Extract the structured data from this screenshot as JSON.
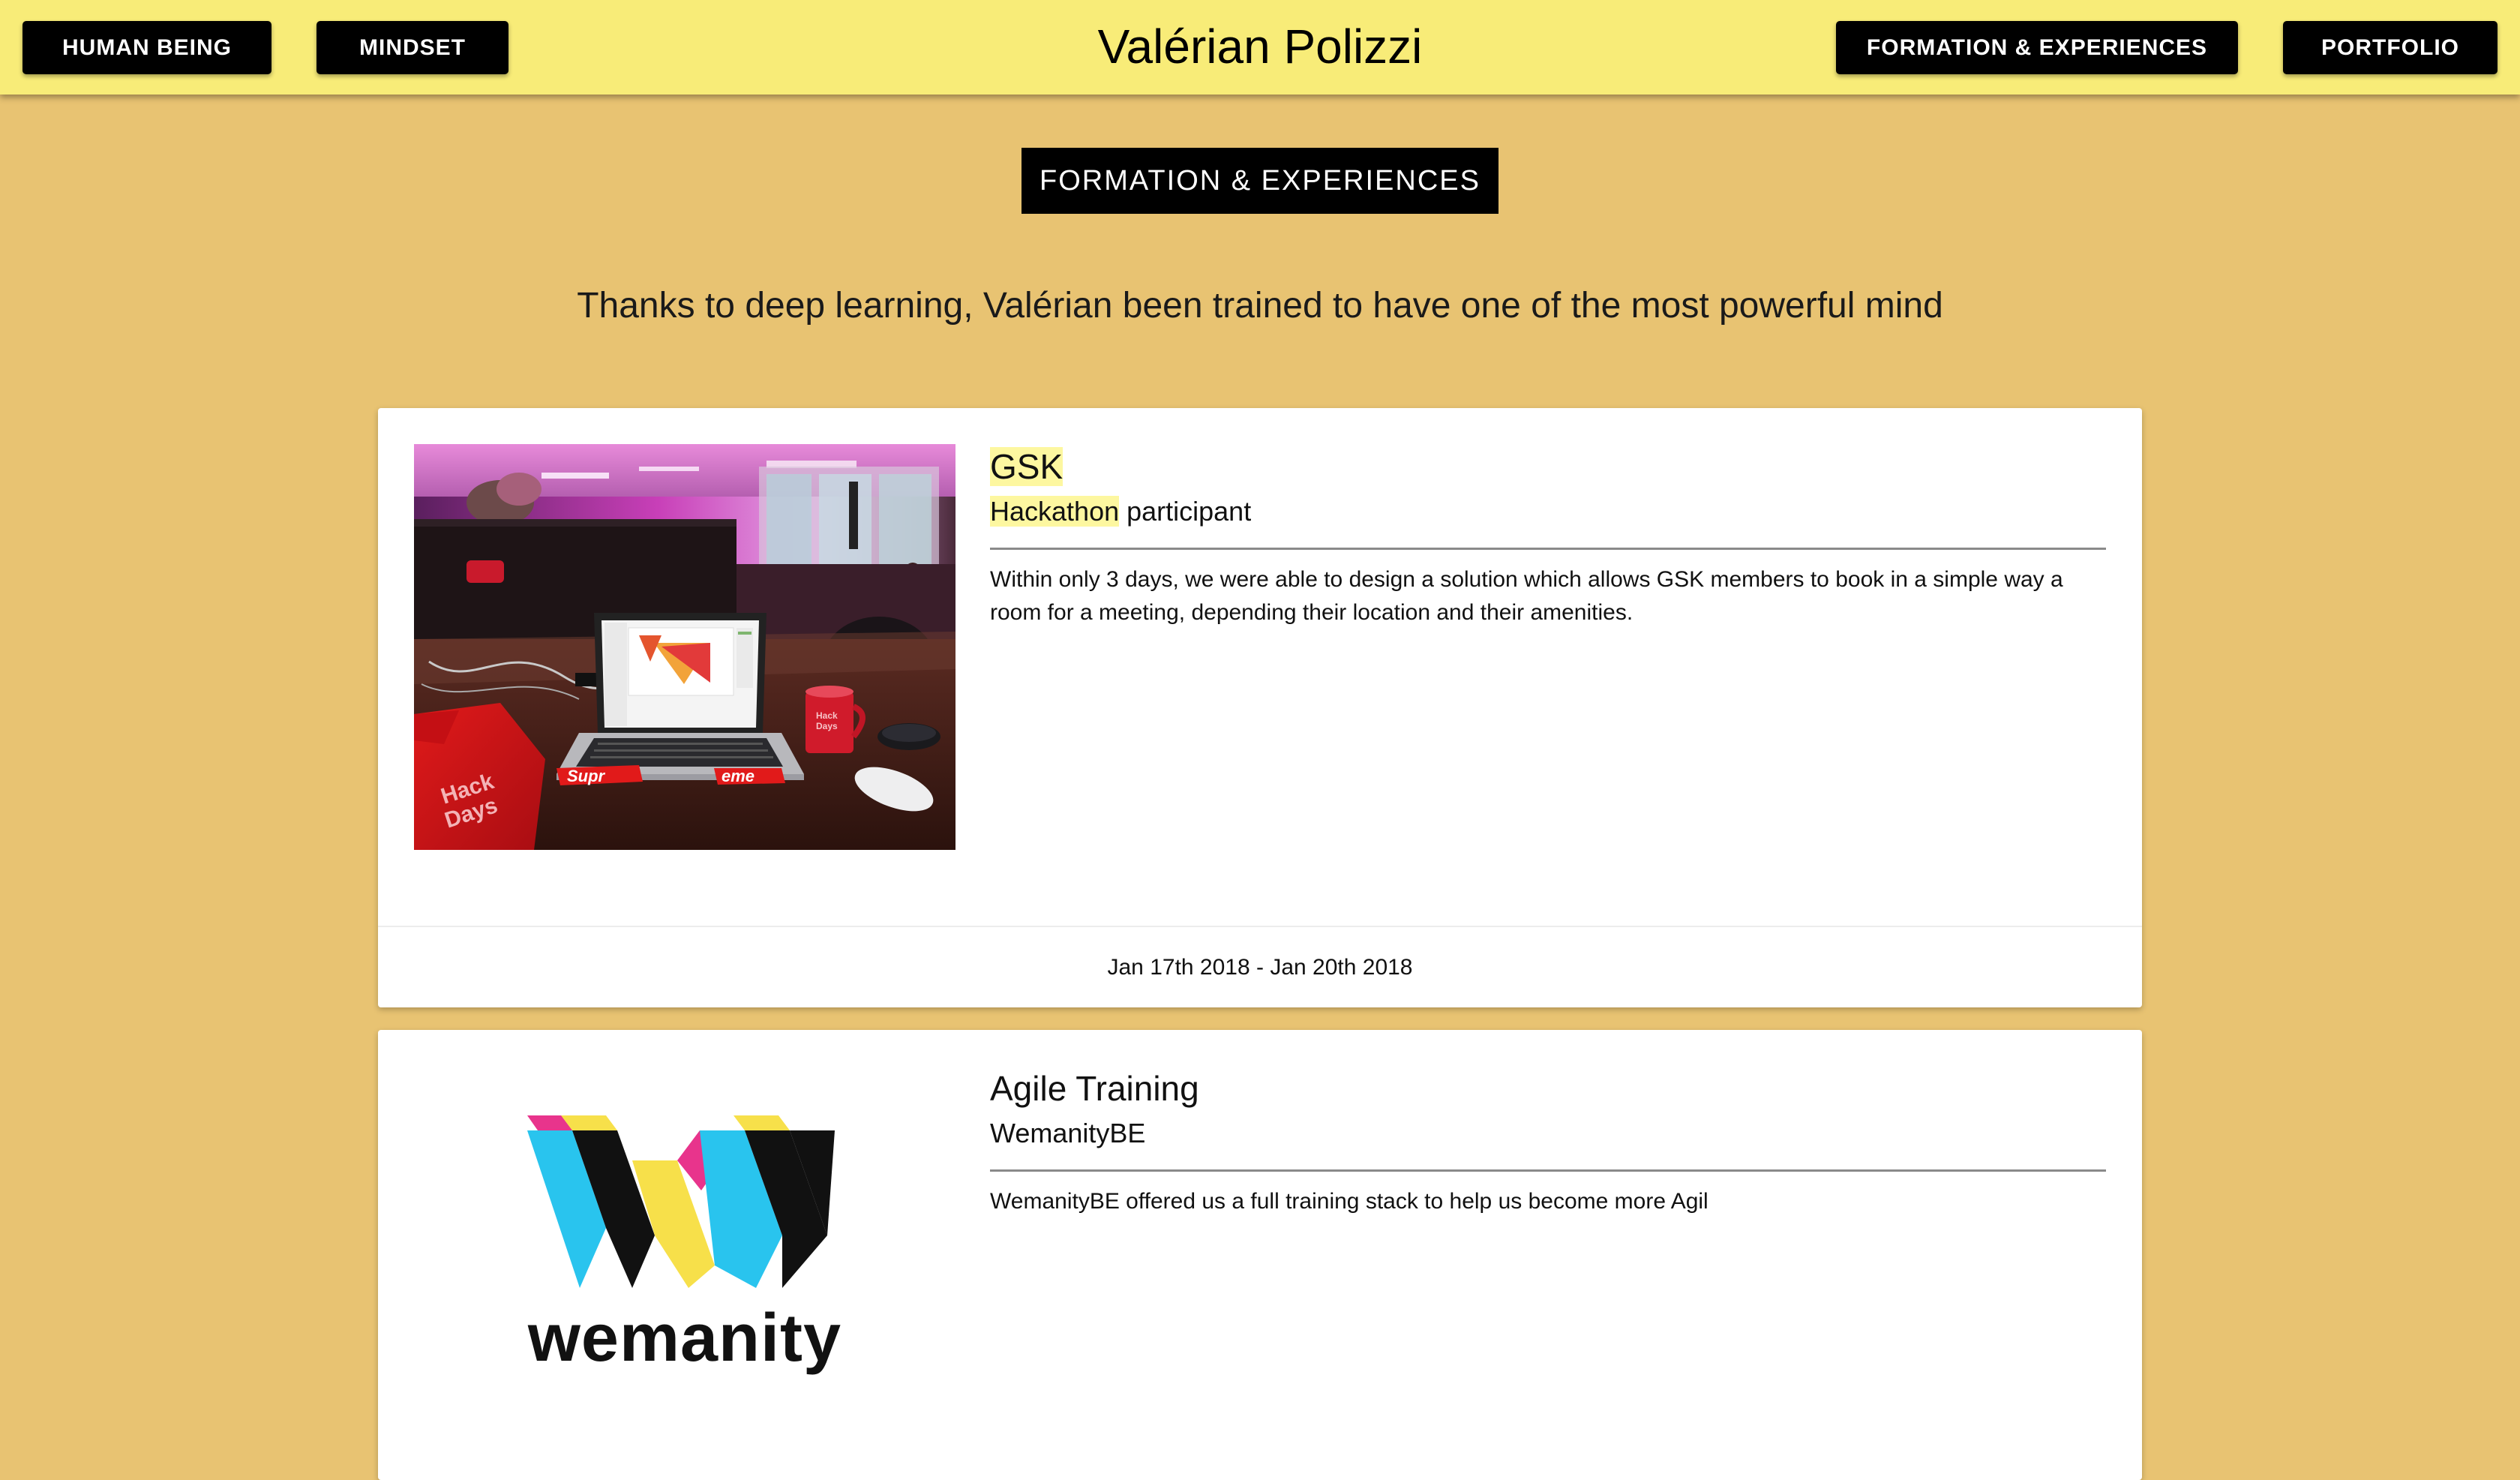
{
  "header": {
    "title": "Valérian Polizzi",
    "nav": {
      "human_being": "HUMAN BEING",
      "mindset": "MINDSET",
      "formation": "FORMATION & EXPERIENCES",
      "portfolio": "PORTFOLIO"
    }
  },
  "section": {
    "badge": "FORMATION & EXPERIENCES",
    "tagline": "Thanks to deep learning, Valérian been trained to have one of the most powerful mind"
  },
  "experiences": [
    {
      "title": "GSK",
      "subtitle_highlight": "Hackathon",
      "subtitle_rest": " participant",
      "description": "Within only 3 days, we were able to design a solution which allows GSK members to book in a simple way a room for a meeting, depending their location and their amenities.",
      "dates": "Jan 17th 2018 - Jan 20th 2018",
      "image_text": {
        "bag": "Supr",
        "bag_end": "eme",
        "shirt_1": "Hack",
        "shirt_2": "Days",
        "mug_1": "Hack",
        "mug_2": "Days"
      }
    },
    {
      "title": "Agile Training",
      "subtitle": "WemanityBE",
      "description": "WemanityBE offered us a full training stack to help us become more Agil",
      "logo_text": "wemanity"
    }
  ],
  "colors": {
    "page_bg": "#e8c372",
    "topbar_bg": "#f8ec78",
    "highlight": "#fdf7a0",
    "logo_cyan": "#29c4ee",
    "logo_yellow": "#f7e04a",
    "logo_magenta": "#e8348c",
    "logo_black": "#111111"
  }
}
